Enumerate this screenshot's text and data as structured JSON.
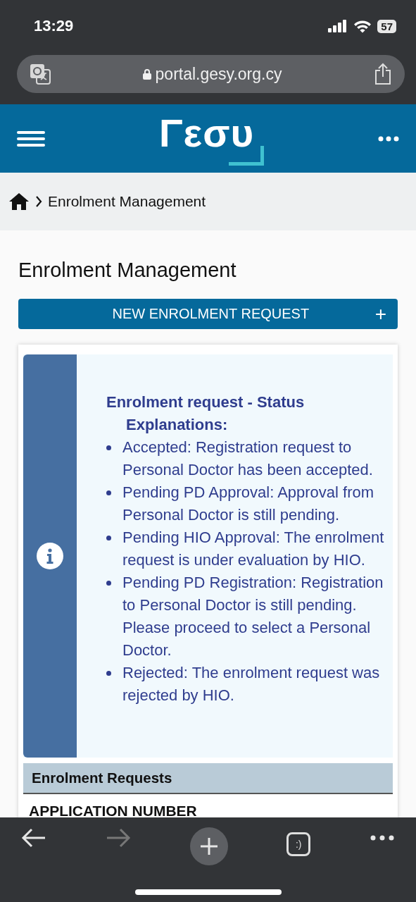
{
  "status_bar": {
    "time": "13:29",
    "battery": "57"
  },
  "browser": {
    "url": "portal.gesy.org.cy"
  },
  "header": {
    "logo": "Γεσυ"
  },
  "breadcrumb": {
    "items": [
      "Enrolment Management"
    ]
  },
  "page": {
    "title": "Enrolment Management",
    "new_button": "NEW ENROLMENT REQUEST",
    "new_button_icon": "+"
  },
  "info": {
    "heading": "Enrolment request - Status Explanations:",
    "items": [
      "Accepted: Registration request to Personal Doctor has been accepted.",
      "Pending PD Approval: Approval from Personal Doctor is still pending.",
      "Pending HIO Approval: The enrolment request is under evaluation by HIO.",
      "Pending PD Registration: Registration to Personal Doctor is still pending. Please proceed to select a Personal Doctor.",
      "Rejected: The enrolment request was rejected by HIO."
    ]
  },
  "table": {
    "title": "Enrolment Requests",
    "columns": [
      "APPLICATION NUMBER"
    ]
  },
  "toolbar": {
    "forward_disabled": true,
    "tabs_label": ":)"
  }
}
